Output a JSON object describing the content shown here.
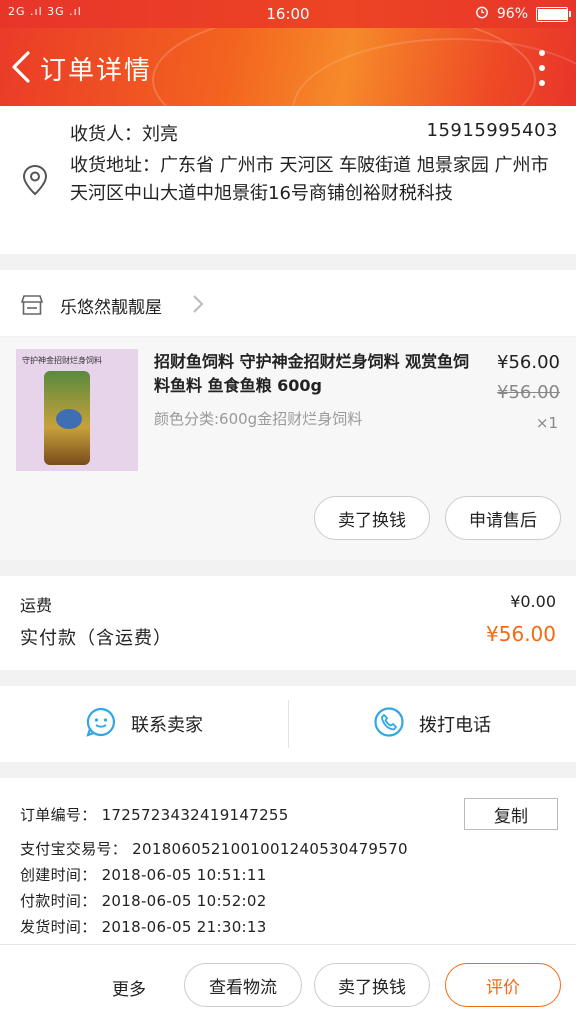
{
  "status_bar": {
    "signal": "2G .ıl 3G .ıl",
    "time": "16:00",
    "battery_text": "96%",
    "battery_level": 0.96
  },
  "header": {
    "title": "订单详情"
  },
  "recipient": {
    "name_label": "收货人：刘亮",
    "phone": "15915995403",
    "address": "收货地址：广东省 广州市 天河区 车陂街道 旭景家园 广州市天河区中山大道中旭景街16号商铺创裕财税科技"
  },
  "shop": {
    "name": "乐悠然靓靓屋"
  },
  "product": {
    "image_banner": "守护神金招财烂身饲料",
    "name": "招财鱼饲料 守护神金招财烂身饲料 观赏鱼饲料鱼料 鱼食鱼粮 600g",
    "spec": "颜色分类:600g金招财烂身饲料",
    "price": "¥56.00",
    "original_price": "¥56.00",
    "quantity": "×1",
    "btn_refund": "卖了换钱",
    "btn_after_sale": "申请售后"
  },
  "fees": {
    "shipping_label": "运费",
    "shipping_value": "¥0.00",
    "paid_label": "实付款（含运费）",
    "paid_value": "¥56.00"
  },
  "contact": {
    "seller": "联系卖家",
    "call": "拨打电话"
  },
  "order_info": {
    "order_no": "订单编号： 1725723432419147255",
    "copy": "复制",
    "alipay_no": "支付宝交易号： 2018060521001001240530479570",
    "created": "创建时间： 2018-06-05 10:51:11",
    "paid": "付款时间： 2018-06-05 10:52:02",
    "shipped": "发货时间： 2018-06-05 21:30:13"
  },
  "bottom_bar": {
    "more": "更多",
    "logistics": "查看物流",
    "resell": "卖了换钱",
    "review": "评价"
  },
  "colors": {
    "brand": "#ea3b28",
    "accent_orange": "#f46a14"
  }
}
